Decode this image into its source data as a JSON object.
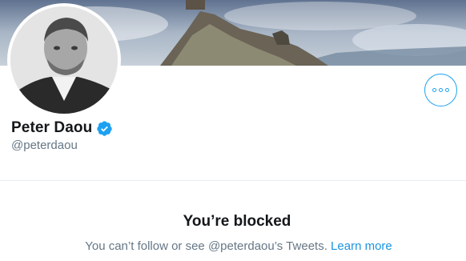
{
  "profile": {
    "display_name": "Peter Daou",
    "handle": "@peterdaou",
    "verified": true
  },
  "icons": {
    "verified": "verified-badge-icon",
    "more": "more-options-icon"
  },
  "blocked": {
    "title": "You’re blocked",
    "message": "You can’t follow or see @peterdaou’s Tweets.",
    "link": "Learn more"
  },
  "colors": {
    "accent": "#1da1f2",
    "link": "#1b95e0",
    "secondary_text": "#657786",
    "divider": "#e6ecf0"
  }
}
